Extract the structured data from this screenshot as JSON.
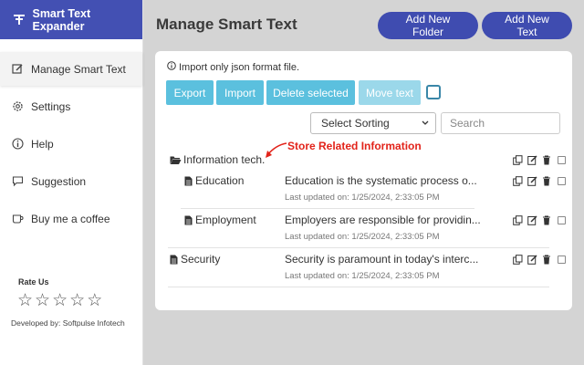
{
  "sidebar": {
    "brand": "Smart Text Expander",
    "items": [
      {
        "label": "Manage Smart Text",
        "icon": "edit-icon",
        "active": true
      },
      {
        "label": "Settings",
        "icon": "gear-icon"
      },
      {
        "label": "Help",
        "icon": "info-icon"
      },
      {
        "label": "Suggestion",
        "icon": "chat-icon"
      },
      {
        "label": "Buy me a coffee",
        "icon": "coffee-icon"
      }
    ],
    "rate_label": "Rate Us",
    "stars": [
      "☆",
      "☆",
      "☆",
      "☆",
      "☆"
    ],
    "developer": "Developed by: Softpulse Infotech"
  },
  "header": {
    "title": "Manage Smart Text",
    "add_folder": "Add New Folder",
    "add_text": "Add New Text"
  },
  "toolbar": {
    "import_note": "Import only json format file.",
    "export": "Export",
    "import": "Import",
    "delete_selected": "Delete selected",
    "move_text": "Move text",
    "sort_selected": "Select Sorting",
    "search_placeholder": "Search"
  },
  "annotation": "Store Related Information",
  "rows": [
    {
      "type": "folder",
      "name": "Information tech."
    },
    {
      "type": "file",
      "name": "Education",
      "desc": "Education is the systematic process o...",
      "updated": "Last updated on: 1/25/2024, 2:33:05 PM"
    },
    {
      "type": "file",
      "name": "Employment",
      "desc": "Employers are responsible for providin...",
      "updated": "Last updated on: 1/25/2024, 2:33:05 PM"
    },
    {
      "type": "file",
      "name": "Security",
      "desc": "Security is paramount in today's interc...",
      "updated": "Last updated on: 1/25/2024, 2:33:05 PM"
    }
  ],
  "colors": {
    "brand": "#4350b3",
    "button_primary": "#3f4cb0",
    "button_action": "#5bc0de",
    "annotation": "#e2231a"
  }
}
